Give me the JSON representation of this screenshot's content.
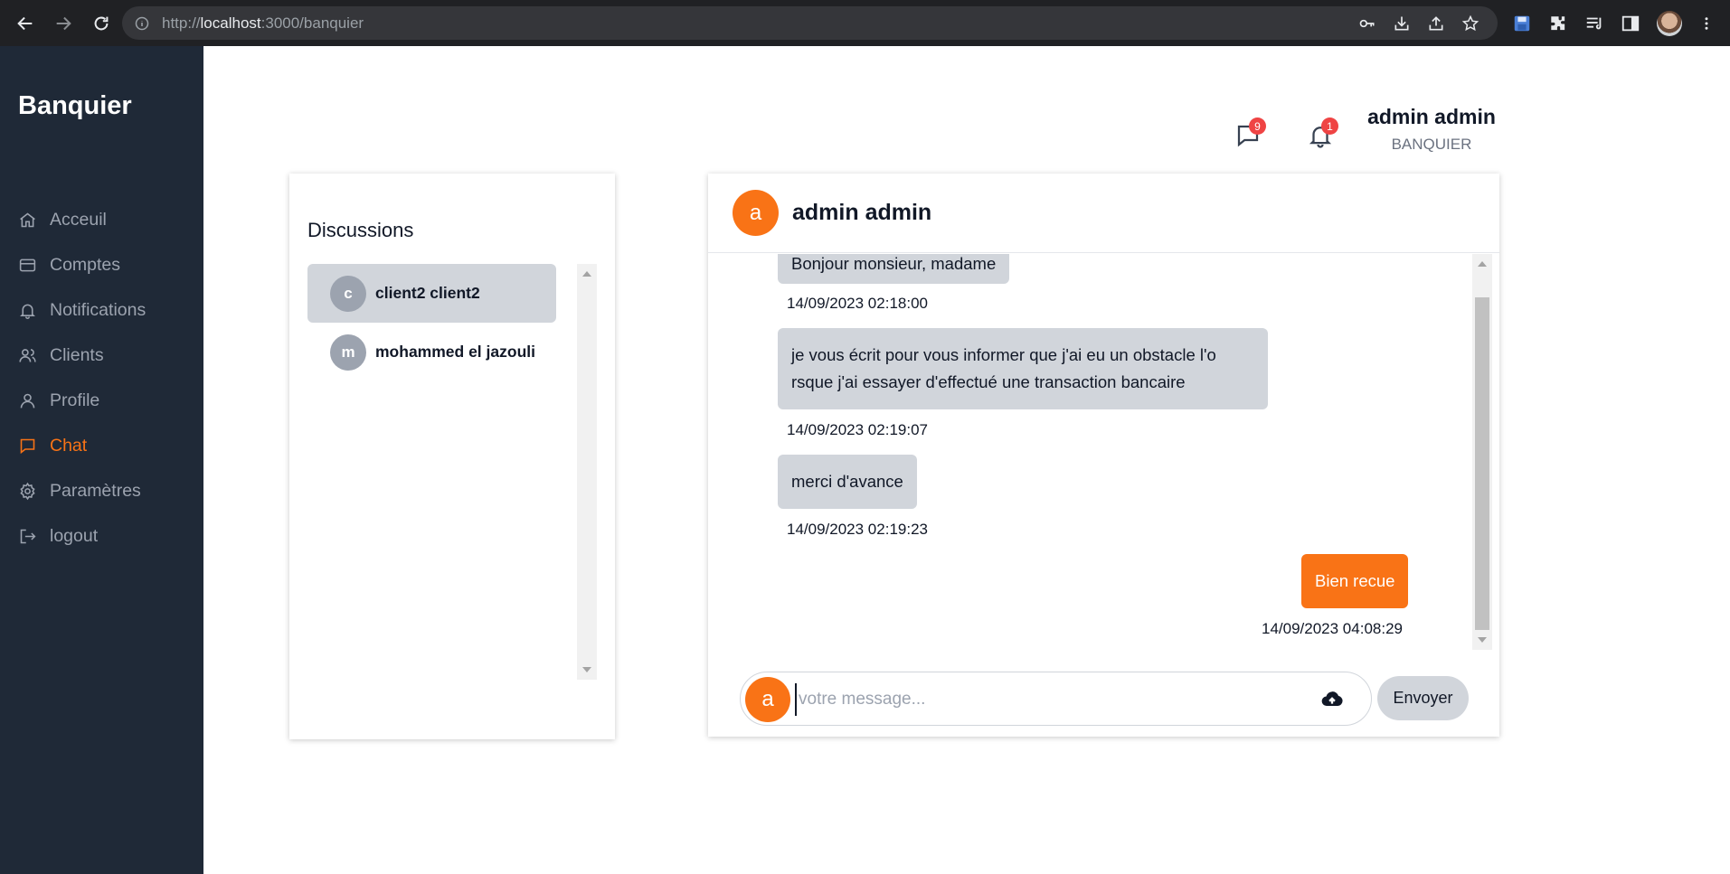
{
  "browser": {
    "url_prefix": "http://",
    "url_host": "localhost",
    "url_rest": ":3000/banquier"
  },
  "sidebar": {
    "brand": "Banquier",
    "items": [
      {
        "label": "Acceuil",
        "icon": "home-icon"
      },
      {
        "label": "Comptes",
        "icon": "card-icon"
      },
      {
        "label": "Notifications",
        "icon": "bell-icon"
      },
      {
        "label": "Clients",
        "icon": "users-icon"
      },
      {
        "label": "Profile",
        "icon": "user-icon"
      },
      {
        "label": "Chat",
        "icon": "chat-icon",
        "active": true
      },
      {
        "label": "Paramètres",
        "icon": "gear-icon"
      },
      {
        "label": "logout",
        "icon": "logout-icon"
      }
    ]
  },
  "header": {
    "messages_count": "9",
    "notifications_count": "1",
    "user_name": "admin admin",
    "user_role": "BANQUIER"
  },
  "discussions": {
    "title": "Discussions",
    "items": [
      {
        "initial": "c",
        "name": "client2 client2",
        "selected": true
      },
      {
        "initial": "m",
        "name": "mohammed el jazouli",
        "selected": false
      }
    ]
  },
  "chat": {
    "avatar_initial": "a",
    "contact_name": "admin admin",
    "messages": [
      {
        "text": "Bonjour monsieur, madame",
        "time": "14/09/2023 02:18:00",
        "direction": "in"
      },
      {
        "text_line1": "je vous écrit pour vous informer que j'ai eu un obstacle l'o",
        "text_line2": "rsque j'ai essayer d'effectué une transaction bancaire",
        "time": "14/09/2023 02:19:07",
        "direction": "in"
      },
      {
        "text": "merci d'avance",
        "time": "14/09/2023 02:19:23",
        "direction": "in"
      },
      {
        "text": "Bien recue",
        "time": "14/09/2023 04:08:29",
        "direction": "out"
      }
    ],
    "input_avatar_initial": "a",
    "input_placeholder": "votre message...",
    "send_label": "Envoyer"
  },
  "colors": {
    "sidebar_bg": "#1f2937",
    "accent": "#f97316",
    "bubble_in": "#d1d5db",
    "badge": "#ef4444"
  }
}
